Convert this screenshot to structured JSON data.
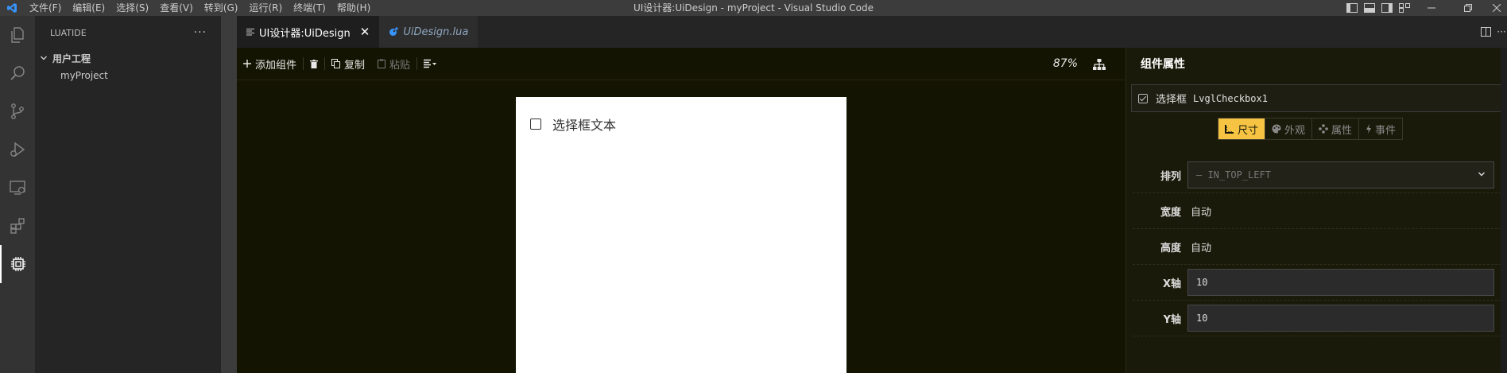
{
  "window": {
    "title": "UI设计器:UiDesign - myProject - Visual Studio Code"
  },
  "menu": [
    "文件(F)",
    "编辑(E)",
    "选择(S)",
    "查看(V)",
    "转到(G)",
    "运行(R)",
    "终端(T)",
    "帮助(H)"
  ],
  "activity_bar": {
    "icons": [
      "explorer-icon",
      "search-icon",
      "source-control-icon",
      "run-debug-icon",
      "remote-explorer-icon",
      "extensions-icon",
      "luatide-icon"
    ]
  },
  "sidebar": {
    "title": "LUATIDE",
    "more": "···",
    "section": "用户工程",
    "items": [
      {
        "label": "myProject"
      }
    ]
  },
  "tabs": [
    {
      "label": "UI设计器:UiDesign",
      "active": true
    },
    {
      "label": "UiDesign.lua",
      "active": false
    }
  ],
  "toolbar": {
    "add": "添加组件",
    "copy": "复制",
    "paste": "粘贴",
    "zoom": "87%"
  },
  "canvas": {
    "checkbox_text": "选择框文本"
  },
  "props": {
    "title": "组件属性",
    "widget_type": "选择框",
    "widget_name": "LvglCheckbox1",
    "tabs": [
      {
        "label": "尺寸",
        "icon": "ruler-icon",
        "active": true
      },
      {
        "label": "外观",
        "icon": "palette-icon",
        "active": false
      },
      {
        "label": "属性",
        "icon": "settings-icon",
        "active": false
      },
      {
        "label": "事件",
        "icon": "lightning-icon",
        "active": false
      }
    ],
    "rows": [
      {
        "label": "排列",
        "kind": "select",
        "value": "— IN_TOP_LEFT"
      },
      {
        "label": "宽度",
        "kind": "text",
        "value": "自动"
      },
      {
        "label": "高度",
        "kind": "text",
        "value": "自动"
      },
      {
        "label": "X轴",
        "kind": "input",
        "value": "10"
      },
      {
        "label": "Y轴",
        "kind": "input",
        "value": "10"
      }
    ]
  },
  "colors": {
    "accent": "#f6c343",
    "designer_bg": "#141402",
    "vscode_blue": "#3794ff"
  }
}
